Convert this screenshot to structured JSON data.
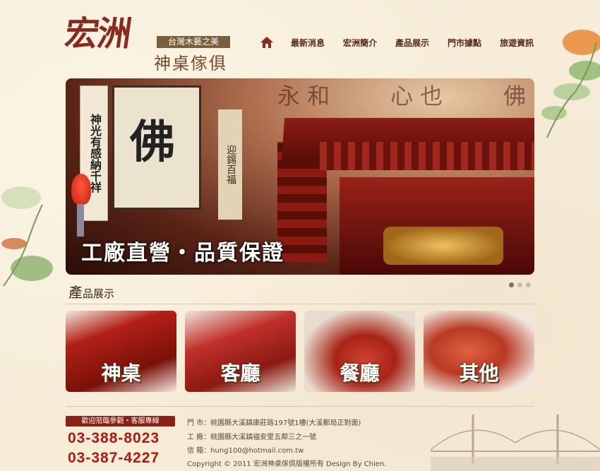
{
  "logo": {
    "title": "宏洲",
    "tagline": "台灣木藝之美",
    "subtitle": "神桌傢俱"
  },
  "nav": {
    "home_icon": "home-icon",
    "items": [
      "最新消息",
      "宏洲簡介",
      "產品展示",
      "門市據點",
      "旅遊資訊"
    ]
  },
  "banner": {
    "slogan": "工廠直營・品質保證",
    "scroll_text": "神光有感納千祥",
    "painting_char": "佛",
    "scroll2_text": "迎錫百福",
    "slides": 3,
    "active_slide": 1
  },
  "products": {
    "title_first": "產",
    "title_rest": "品展示",
    "items": [
      {
        "label": "神桌"
      },
      {
        "label": "客廳"
      },
      {
        "label": "餐廳"
      },
      {
        "label": "其他"
      }
    ]
  },
  "footer": {
    "welcome": "歡迎蒞臨參觀・客服專線",
    "phone1": "03-388-8023",
    "phone2": "03-387-4227",
    "store": "門 市：桃園縣大溪鎮康莊路197號1樓(大溪郵局正對面)",
    "factory": "工 廠：桃園縣大溪鎮福安里五鄰三之一號",
    "email": "信 箱：hung100@hotmail.com.tw",
    "copyright": "Copyright © 2011 宏洲神桌傢俱版權所有 Design By Chien."
  }
}
